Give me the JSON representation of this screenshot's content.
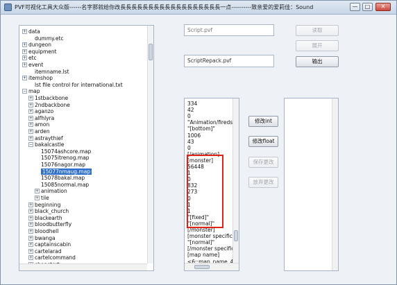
{
  "window": {
    "title": "PVF可视化工具大众版------名字那就给你改長長長長長長長長長長長長長長長長長長一点----------致亲爱的爱莉佳：Sound",
    "controls": {
      "minimize": "—",
      "maximize": "□",
      "close": "✕"
    }
  },
  "tree": {
    "items": [
      {
        "label": "data",
        "expander": "+",
        "selected": false
      },
      {
        "label": "dummy.etc",
        "expander": "",
        "selected": false
      },
      {
        "label": "dungeon",
        "expander": "+",
        "selected": false
      },
      {
        "label": "equipment",
        "expander": "+",
        "selected": false
      },
      {
        "label": "etc",
        "expander": "+",
        "selected": false
      },
      {
        "label": "event",
        "expander": "+",
        "selected": false
      },
      {
        "label": "itemname.lst",
        "expander": "",
        "selected": false
      },
      {
        "label": "itemshop",
        "expander": "+",
        "selected": false
      },
      {
        "label": "lst file control for international.txt",
        "expander": "",
        "selected": false
      },
      {
        "label": "map",
        "expander": "−",
        "selected": false
      },
      {
        "label": "1stbackbone",
        "expander": "+",
        "selected": false
      },
      {
        "label": "2ndbackbone",
        "expander": "+",
        "selected": false
      },
      {
        "label": "aganzo",
        "expander": "+",
        "selected": false
      },
      {
        "label": "alfhlyra",
        "expander": "+",
        "selected": false
      },
      {
        "label": "amon",
        "expander": "+",
        "selected": false
      },
      {
        "label": "arden",
        "expander": "+",
        "selected": false
      },
      {
        "label": "astraythief",
        "expander": "+",
        "selected": false
      },
      {
        "label": "bakalcastle",
        "expander": "−",
        "selected": false
      },
      {
        "label": "15074ashcore.map",
        "expander": "",
        "selected": false
      },
      {
        "label": "15075itrenog.map",
        "expander": "",
        "selected": false
      },
      {
        "label": "15076nagor.map",
        "expander": "",
        "selected": false
      },
      {
        "label": "15077nmaug.map",
        "expander": "",
        "selected": true
      },
      {
        "label": "15078bakal.map",
        "expander": "",
        "selected": false
      },
      {
        "label": "15085normal.map",
        "expander": "",
        "selected": false
      },
      {
        "label": "animation",
        "expander": "+",
        "selected": false
      },
      {
        "label": "tile",
        "expander": "+",
        "selected": false
      },
      {
        "label": "beginning",
        "expander": "+",
        "selected": false
      },
      {
        "label": "black_church",
        "expander": "+",
        "selected": false
      },
      {
        "label": "blackearth",
        "expander": "+",
        "selected": false
      },
      {
        "label": "bloodbutterfly",
        "expander": "+",
        "selected": false
      },
      {
        "label": "bloodhell",
        "expander": "+",
        "selected": false
      },
      {
        "label": "bwanga",
        "expander": "+",
        "selected": false
      },
      {
        "label": "captainscabin",
        "expander": "+",
        "selected": false
      },
      {
        "label": "cartelarad",
        "expander": "+",
        "selected": false
      },
      {
        "label": "cartelcommand",
        "expander": "+",
        "selected": false
      },
      {
        "label": "chapstert",
        "expander": "+",
        "selected": false
      }
    ]
  },
  "fields": {
    "pvf_path": {
      "value": "Script.pvf"
    },
    "repack_path": {
      "value": "ScriptRepack.pvf"
    }
  },
  "buttons": {
    "read": "读取",
    "unpack": "展开",
    "export": "输出",
    "modify_int": "修改int",
    "modify_float": "修改float",
    "save_changes": "保存更改",
    "discard_changes": "放弃更改"
  },
  "content_lines": [
    "334",
    "42",
    "0",
    "\"Animation/firedsl",
    "\"[bottom]\"",
    "1006",
    "43",
    "0",
    "[/animation]",
    "[monster]",
    "56448",
    "1",
    "0",
    "832",
    "273",
    "0",
    "1",
    "1",
    "\"[fixed]\"",
    "\"[normal]\"",
    "[/monster]",
    "[monster specific",
    "\"[normal]\"",
    "[/monster specific",
    "[map name]",
    "<6::map_name_4"
  ],
  "colors": {
    "selection_box": "#e0201a",
    "tree_selected": "#2f6fce",
    "window_bg": "#eef1f5"
  }
}
